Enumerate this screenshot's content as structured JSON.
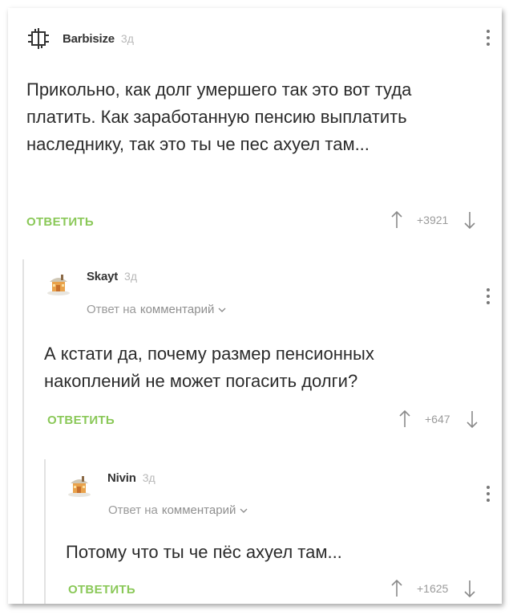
{
  "comments": [
    {
      "username": "Barbisize",
      "time": "3д",
      "text": "Прикольно, как долг умершего так это вот туда платить. Как заработанную пенсию выплатить наследнику, так это ты че пес ахуел там...",
      "reply_label": "ОТВЕТИТЬ",
      "rating": "+3921",
      "avatar_icon": "rammstein-logo-icon"
    },
    {
      "username": "Skayt",
      "time": "3д",
      "reply_to_prefix": "Ответ на",
      "reply_to_link": "комментарий",
      "text": "А кстати да, почему размер пенсионных накоплений не может погасить долги?",
      "reply_label": "ОТВЕТИТЬ",
      "rating": "+647",
      "avatar_icon": "cottage-avatar-icon"
    },
    {
      "username": "Nivin",
      "time": "3д",
      "reply_to_prefix": "Ответ на",
      "reply_to_link": "комментарий",
      "text": "Потому что ты че пёс ахуел там...",
      "reply_label": "ОТВЕТИТЬ",
      "rating": "+1625",
      "avatar_icon": "cottage-avatar-icon"
    }
  ],
  "colors": {
    "accent_green": "#8ac858",
    "text": "#2b2b2b",
    "muted": "#9a9a9a"
  }
}
